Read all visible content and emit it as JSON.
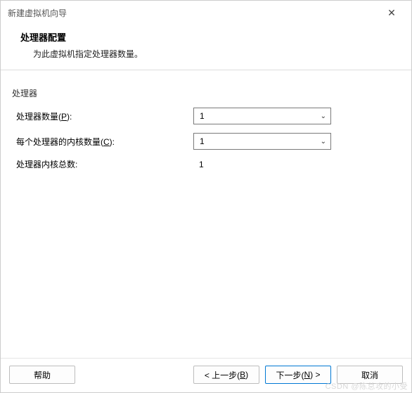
{
  "titlebar": {
    "title": "新建虚拟机向导"
  },
  "header": {
    "title": "处理器配置",
    "desc": "为此虚拟机指定处理器数量。"
  },
  "group": {
    "label": "处理器"
  },
  "fields": {
    "processor_count": {
      "label_prefix": "处理器数量(",
      "hotkey": "P",
      "label_suffix": "):",
      "value": "1"
    },
    "cores_per_processor": {
      "label_prefix": "每个处理器的内核数量(",
      "hotkey": "C",
      "label_suffix": "):",
      "value": "1"
    },
    "total_cores": {
      "label": "处理器内核总数:",
      "value": "1"
    }
  },
  "footer": {
    "help": "帮助",
    "back_prefix": "< 上一步(",
    "back_hotkey": "B",
    "back_suffix": ")",
    "next_prefix": "下一步(",
    "next_hotkey": "N",
    "next_suffix": ") >",
    "cancel": "取消"
  },
  "watermark": "CSDN @陈总攻的小受"
}
